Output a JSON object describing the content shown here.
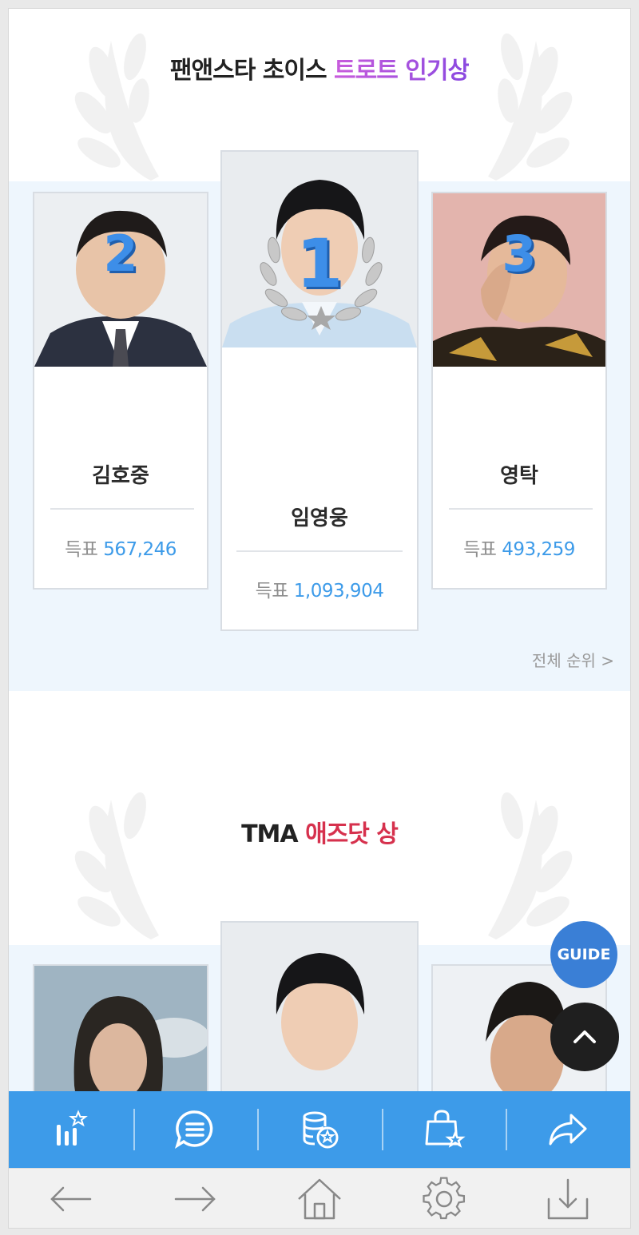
{
  "section1": {
    "title_prefix": "팬앤스타 초이스",
    "title_highlight": "트로트 인기상",
    "first": {
      "rank": "1",
      "name": "임영웅",
      "votes_label": "득표",
      "votes": "1,093,904"
    },
    "second": {
      "rank": "2",
      "name": "김호중",
      "votes_label": "득표",
      "votes": "567,246"
    },
    "third": {
      "rank": "3",
      "name": "영탁",
      "votes_label": "득표",
      "votes": "493,259"
    },
    "ranking_link": "전체 순위 >"
  },
  "section2": {
    "title_prefix": "TMA",
    "title_highlight": "애즈닷 상"
  },
  "fab": {
    "guide_label": "GUIDE"
  },
  "toolbar": {
    "items": [
      {
        "icon": "ranking-chart-star-icon"
      },
      {
        "icon": "chat-bubble-icon"
      },
      {
        "icon": "coin-stack-star-icon"
      },
      {
        "icon": "shopping-bag-star-icon"
      },
      {
        "icon": "share-arrow-icon"
      }
    ]
  },
  "browser": {
    "items": [
      {
        "icon": "back-arrow-icon"
      },
      {
        "icon": "forward-arrow-icon"
      },
      {
        "icon": "home-icon"
      },
      {
        "icon": "settings-gear-icon"
      },
      {
        "icon": "download-icon"
      }
    ]
  },
  "colors": {
    "accent_blue": "#3d9be9",
    "highlight_purple": "#a552de",
    "highlight_red": "#d6314d",
    "band": "#eef6fd"
  }
}
